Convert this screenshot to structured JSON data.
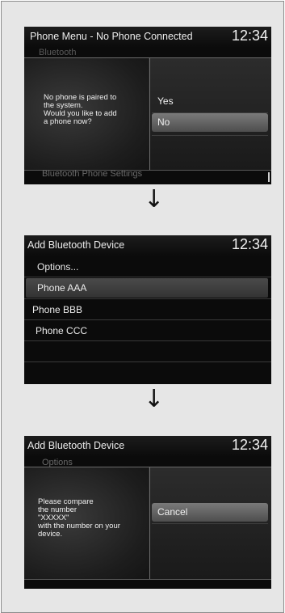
{
  "screen1": {
    "title": "Phone Menu - No Phone Connected",
    "time": "12:34",
    "bg_text_top": "Bluetooth",
    "bg_text_bottom": "Bluetooth Phone Settings",
    "message_lines": [
      "No phone is paired to",
      "the system.",
      "Would you like to add",
      "a phone now?"
    ],
    "options": [
      "Yes",
      "No"
    ],
    "selected_option": "No"
  },
  "arrow1": "↓",
  "screen2": {
    "title": "Add Bluetooth Device",
    "time": "12:34",
    "items": [
      "Options...",
      "Phone AAA",
      "Phone BBB",
      "Phone CCC"
    ],
    "selected_item": "Phone AAA"
  },
  "arrow2": "↓",
  "screen3": {
    "title": "Add Bluetooth Device",
    "time": "12:34",
    "bg_text_top": "Options",
    "message_lines": [
      "Please compare",
      "the number",
      "\"XXXXX\"",
      "with the number on your",
      "device."
    ],
    "options": [
      "Cancel"
    ],
    "selected_option": "Cancel"
  },
  "colors": {
    "screen_bg": "#0b0b0b",
    "panel_bg": "#e6e6e6",
    "highlight": "#6a6a6a",
    "text": "#f0f0f0"
  }
}
